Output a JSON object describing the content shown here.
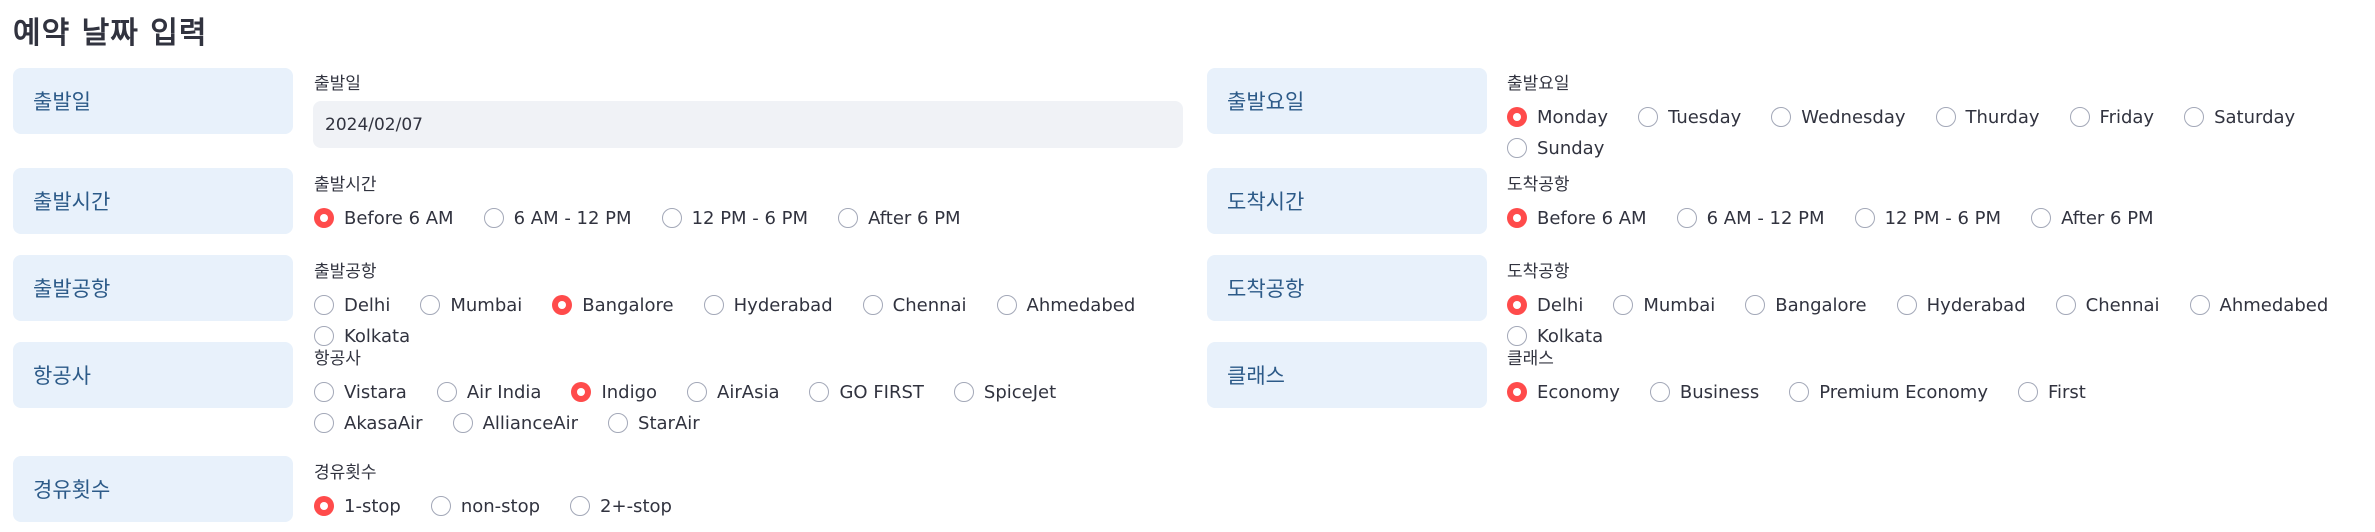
{
  "page_title": "예약 날짜 입력",
  "accent_color": "#ff4b4b",
  "sections": {
    "departure_date": {
      "label": "출발일",
      "caption": "출발일",
      "value": "2024/02/07"
    },
    "departure_weekday": {
      "label": "출발요일",
      "caption": "출발요일",
      "selected": "Monday",
      "options": [
        "Monday",
        "Tuesday",
        "Wednesday",
        "Thurday",
        "Friday",
        "Saturday",
        "Sunday"
      ]
    },
    "departure_time": {
      "label": "출발시간",
      "caption": "출발시간",
      "selected": "Before 6 AM",
      "options": [
        "Before 6 AM",
        "6 AM - 12 PM",
        "12 PM - 6 PM",
        "After 6 PM"
      ]
    },
    "arrival_time": {
      "label": "도착시간",
      "caption": "도착공항",
      "selected": "Before 6 AM",
      "options": [
        "Before 6 AM",
        "6 AM - 12 PM",
        "12 PM - 6 PM",
        "After 6 PM"
      ]
    },
    "departure_airport": {
      "label": "출발공항",
      "caption": "출발공항",
      "selected": "Bangalore",
      "options": [
        "Delhi",
        "Mumbai",
        "Bangalore",
        "Hyderabad",
        "Chennai",
        "Ahmedabed",
        "Kolkata"
      ]
    },
    "arrival_airport": {
      "label": "도착공항",
      "caption": "도착공항",
      "selected": "Delhi",
      "options": [
        "Delhi",
        "Mumbai",
        "Bangalore",
        "Hyderabad",
        "Chennai",
        "Ahmedabed",
        "Kolkata"
      ]
    },
    "airline": {
      "label": "항공사",
      "caption": "항공사",
      "selected": "Indigo",
      "options": [
        "Vistara",
        "Air India",
        "Indigo",
        "AirAsia",
        "GO FIRST",
        "SpiceJet",
        "AkasaAir",
        "AllianceAir",
        "StarAir"
      ]
    },
    "travel_class": {
      "label": "클래스",
      "caption": "클래스",
      "selected": "Economy",
      "options": [
        "Economy",
        "Business",
        "Premium Economy",
        "First"
      ]
    },
    "stops": {
      "label": "경유횟수",
      "caption": "경유횟수",
      "selected": "1-stop",
      "options": [
        "1-stop",
        "non-stop",
        "2+-stop"
      ]
    }
  }
}
